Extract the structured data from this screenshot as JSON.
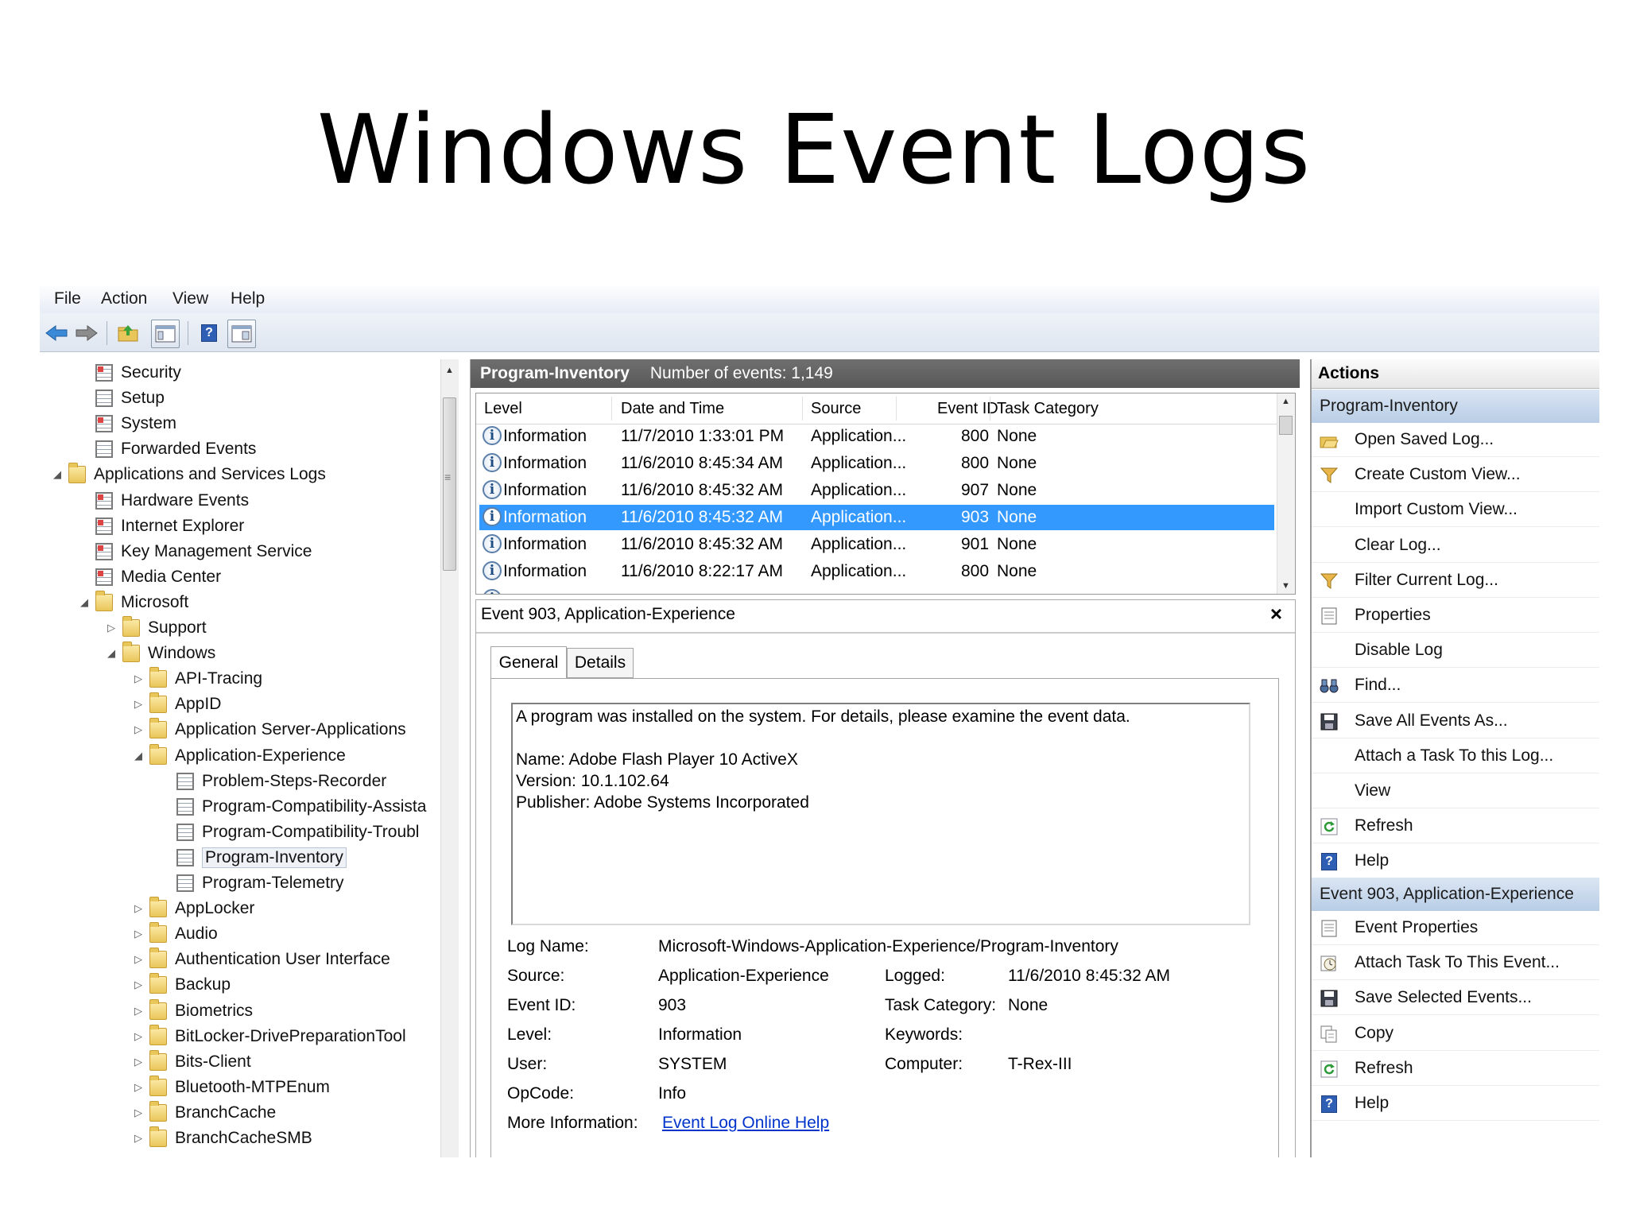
{
  "slide_title": "Windows Event Logs",
  "menu": [
    "File",
    "Action",
    "View",
    "Help"
  ],
  "tree": [
    {
      "label": "Security",
      "indent": 2,
      "icon": "log-red",
      "arrow": ""
    },
    {
      "label": "Setup",
      "indent": 2,
      "icon": "log",
      "arrow": ""
    },
    {
      "label": "System",
      "indent": 2,
      "icon": "log-red",
      "arrow": ""
    },
    {
      "label": "Forwarded Events",
      "indent": 2,
      "icon": "log",
      "arrow": ""
    },
    {
      "label": "Applications and Services Logs",
      "indent": 1,
      "icon": "folder",
      "arrow": "◢"
    },
    {
      "label": "Hardware Events",
      "indent": 2,
      "icon": "log-red",
      "arrow": ""
    },
    {
      "label": "Internet Explorer",
      "indent": 2,
      "icon": "log-red",
      "arrow": ""
    },
    {
      "label": "Key Management Service",
      "indent": 2,
      "icon": "log-red",
      "arrow": ""
    },
    {
      "label": "Media Center",
      "indent": 2,
      "icon": "log-red",
      "arrow": ""
    },
    {
      "label": "Microsoft",
      "indent": 2,
      "icon": "folder",
      "arrow": "◢"
    },
    {
      "label": "Support",
      "indent": 3,
      "icon": "folder",
      "arrow": "▷"
    },
    {
      "label": "Windows",
      "indent": 3,
      "icon": "folder",
      "arrow": "◢"
    },
    {
      "label": "API-Tracing",
      "indent": 4,
      "icon": "folder",
      "arrow": "▷"
    },
    {
      "label": "AppID",
      "indent": 4,
      "icon": "folder",
      "arrow": "▷"
    },
    {
      "label": "Application Server-Applications",
      "indent": 4,
      "icon": "folder",
      "arrow": "▷"
    },
    {
      "label": "Application-Experience",
      "indent": 4,
      "icon": "folder",
      "arrow": "◢"
    },
    {
      "label": "Problem-Steps-Recorder",
      "indent": 5,
      "icon": "log",
      "arrow": ""
    },
    {
      "label": "Program-Compatibility-Assista",
      "indent": 5,
      "icon": "log",
      "arrow": ""
    },
    {
      "label": "Program-Compatibility-Troubl",
      "indent": 5,
      "icon": "log",
      "arrow": ""
    },
    {
      "label": "Program-Inventory",
      "indent": 5,
      "icon": "log",
      "arrow": "",
      "selected": true
    },
    {
      "label": "Program-Telemetry",
      "indent": 5,
      "icon": "log",
      "arrow": ""
    },
    {
      "label": "AppLocker",
      "indent": 4,
      "icon": "folder",
      "arrow": "▷"
    },
    {
      "label": "Audio",
      "indent": 4,
      "icon": "folder",
      "arrow": "▷"
    },
    {
      "label": "Authentication User Interface",
      "indent": 4,
      "icon": "folder",
      "arrow": "▷"
    },
    {
      "label": "Backup",
      "indent": 4,
      "icon": "folder",
      "arrow": "▷"
    },
    {
      "label": "Biometrics",
      "indent": 4,
      "icon": "folder",
      "arrow": "▷"
    },
    {
      "label": "BitLocker-DrivePreparationTool",
      "indent": 4,
      "icon": "folder",
      "arrow": "▷"
    },
    {
      "label": "Bits-Client",
      "indent": 4,
      "icon": "folder",
      "arrow": "▷"
    },
    {
      "label": "Bluetooth-MTPEnum",
      "indent": 4,
      "icon": "folder",
      "arrow": "▷"
    },
    {
      "label": "BranchCache",
      "indent": 4,
      "icon": "folder",
      "arrow": "▷"
    },
    {
      "label": "BranchCacheSMB",
      "indent": 4,
      "icon": "folder",
      "arrow": "▷"
    }
  ],
  "log_header": {
    "name": "Program-Inventory",
    "count": "Number of events: 1,149"
  },
  "columns": [
    "Level",
    "Date and Time",
    "Source",
    "Event ID",
    "Task Category"
  ],
  "events": [
    {
      "level": "Information",
      "date": "11/7/2010 1:33:01 PM",
      "source": "Application...",
      "id": "800",
      "task": "None"
    },
    {
      "level": "Information",
      "date": "11/6/2010 8:45:34 AM",
      "source": "Application...",
      "id": "800",
      "task": "None"
    },
    {
      "level": "Information",
      "date": "11/6/2010 8:45:32 AM",
      "source": "Application...",
      "id": "907",
      "task": "None"
    },
    {
      "level": "Information",
      "date": "11/6/2010 8:45:32 AM",
      "source": "Application...",
      "id": "903",
      "task": "None",
      "selected": true
    },
    {
      "level": "Information",
      "date": "11/6/2010 8:45:32 AM",
      "source": "Application...",
      "id": "901",
      "task": "None"
    },
    {
      "level": "Information",
      "date": "11/6/2010 8:22:17 AM",
      "source": "Application...",
      "id": "800",
      "task": "None"
    }
  ],
  "detail": {
    "title": "Event 903, Application-Experience",
    "close": "×",
    "tabs": [
      "General",
      "Details"
    ],
    "description": [
      "A program was installed on the system. For details, please examine the event data.",
      "",
      "Name: Adobe Flash Player 10 ActiveX",
      "Version: 10.1.102.64",
      "Publisher: Adobe Systems Incorporated"
    ],
    "log_name_label": "Log Name:",
    "log_name": "Microsoft-Windows-Application-Experience/Program-Inventory",
    "source_label": "Source:",
    "source": "Application-Experience",
    "logged_label": "Logged:",
    "logged": "11/6/2010 8:45:32 AM",
    "event_id_label": "Event ID:",
    "event_id": "903",
    "task_label": "Task Category:",
    "task": "None",
    "level_label": "Level:",
    "level": "Information",
    "keywords_label": "Keywords:",
    "user_label": "User:",
    "user": "SYSTEM",
    "computer_label": "Computer:",
    "computer": "T-Rex-III",
    "opcode_label": "OpCode:",
    "opcode": "Info",
    "more_label": "More Information:",
    "more_link": "Event Log Online Help"
  },
  "actions": {
    "title": "Actions",
    "section1": "Program-Inventory",
    "items1": [
      {
        "label": "Open Saved Log...",
        "icon": "open-folder-icon"
      },
      {
        "label": "Create Custom View...",
        "icon": "filter-icon"
      },
      {
        "label": "Import Custom View...",
        "icon": ""
      },
      {
        "label": "Clear Log...",
        "icon": ""
      },
      {
        "label": "Filter Current Log...",
        "icon": "filter-icon"
      },
      {
        "label": "Properties",
        "icon": "properties-icon"
      },
      {
        "label": "Disable Log",
        "icon": ""
      },
      {
        "label": "Find...",
        "icon": "binoculars-icon"
      },
      {
        "label": "Save All Events As...",
        "icon": "save-icon"
      },
      {
        "label": "Attach a Task To this Log...",
        "icon": ""
      },
      {
        "label": "View",
        "icon": ""
      },
      {
        "label": "Refresh",
        "icon": "refresh-icon"
      },
      {
        "label": "Help",
        "icon": "help-icon"
      }
    ],
    "section2": "Event 903, Application-Experience",
    "items2": [
      {
        "label": "Event Properties",
        "icon": "properties-icon"
      },
      {
        "label": "Attach Task To This Event...",
        "icon": "task-clock-icon"
      },
      {
        "label": "Save Selected Events...",
        "icon": "save-icon"
      },
      {
        "label": "Copy",
        "icon": "copy-icon"
      },
      {
        "label": "Refresh",
        "icon": "refresh-icon"
      },
      {
        "label": "Help",
        "icon": "help-icon"
      }
    ]
  }
}
